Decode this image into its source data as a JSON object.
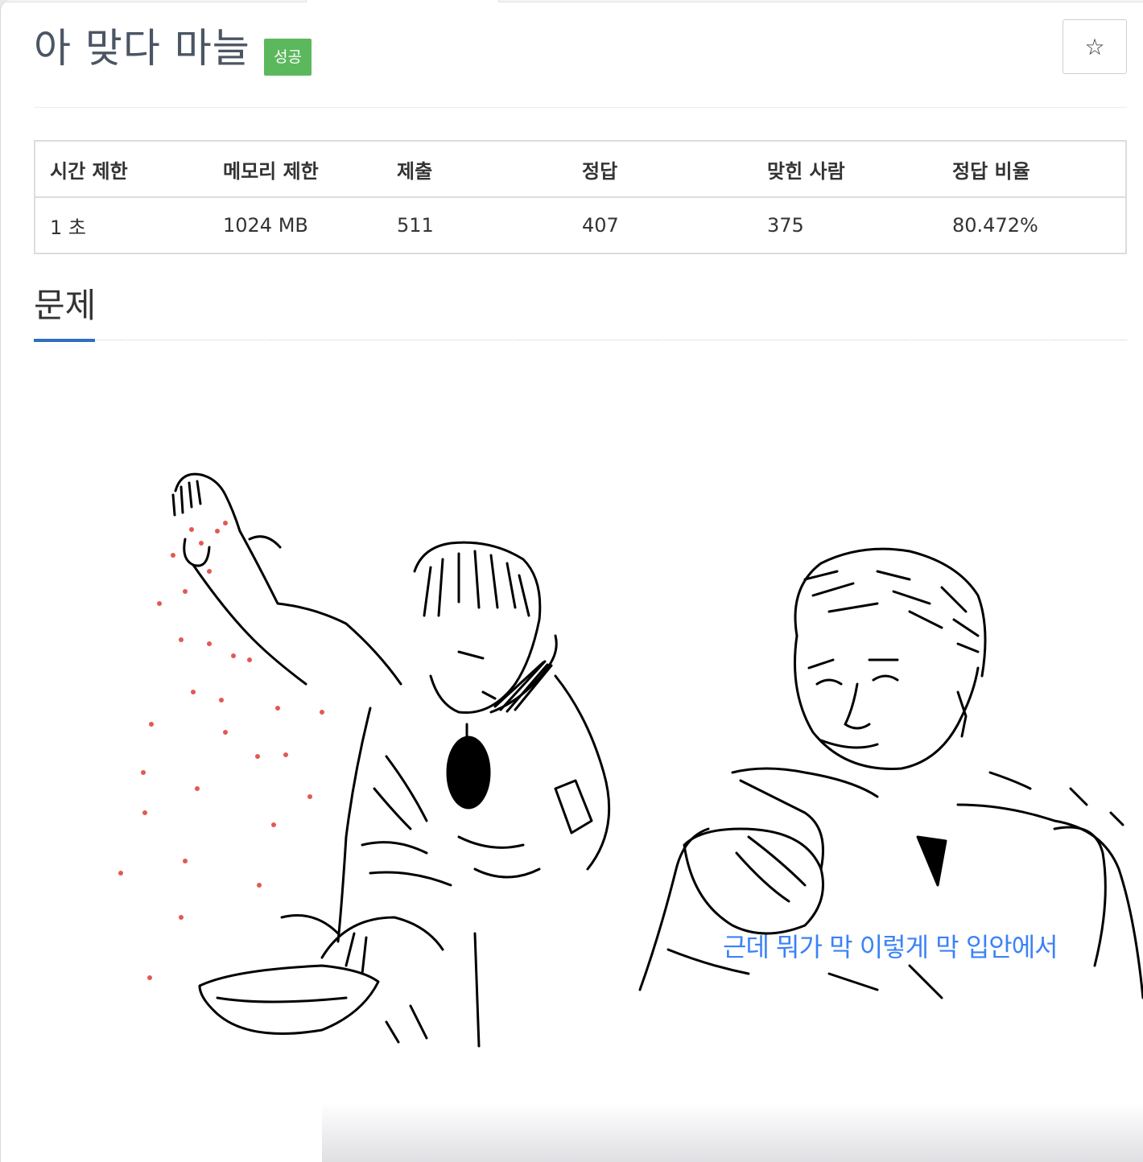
{
  "problem": {
    "title": "아 맞다 마늘",
    "status_badge": "성공",
    "star_icon": "☆"
  },
  "info_table": {
    "headers": [
      "시간 제한",
      "메모리 제한",
      "제출",
      "정답",
      "맞힌 사람",
      "정답 비율"
    ],
    "row": [
      "1 초",
      "1024 MB",
      "511",
      "407",
      "375",
      "80.472%"
    ]
  },
  "section": {
    "title": "문제"
  },
  "illustration": {
    "caption": "근데 뭐가 막 이렇게 막 입안에서"
  },
  "colors": {
    "badge_green": "#5cb85c",
    "accent_blue": "#2e6fbd",
    "caption_blue": "#3b82f6",
    "garlic_red": "#e05a52"
  }
}
